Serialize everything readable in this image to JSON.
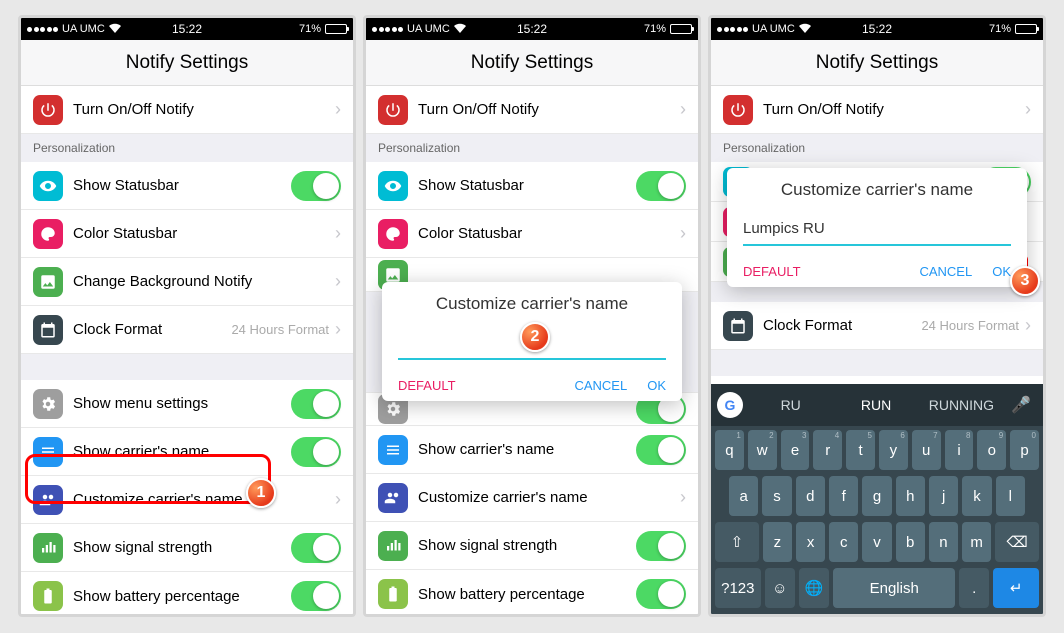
{
  "statusbar": {
    "carrier": "UA UMC",
    "time": "15:22",
    "battery_pct": "71%"
  },
  "title": "Notify Settings",
  "rows": {
    "turn_on_off": "Turn On/Off Notify",
    "personalization": "Personalization",
    "show_statusbar": "Show Statusbar",
    "color_statusbar": "Color Statusbar",
    "change_bg": "Change Background Notify",
    "clock_format": "Clock Format",
    "clock_format_detail": "24 Hours Format",
    "show_menu": "Show menu settings",
    "show_carrier": "Show carrier's name",
    "customize_carrier": "Customize carrier's name",
    "show_signal": "Show signal strength",
    "show_battery": "Show battery percentage"
  },
  "dialog": {
    "title": "Customize carrier's name",
    "empty_value": "",
    "value": "Lumpics RU",
    "default": "DEFAULT",
    "cancel": "CANCEL",
    "ok": "OK"
  },
  "callouts": {
    "n1": "1",
    "n2": "2",
    "n3": "3"
  },
  "keyboard": {
    "suggestions": [
      "RU",
      "RUN",
      "RUNNING"
    ],
    "row1": [
      "q",
      "w",
      "e",
      "r",
      "t",
      "y",
      "u",
      "i",
      "o",
      "p"
    ],
    "row1_sup": [
      "1",
      "2",
      "3",
      "4",
      "5",
      "6",
      "7",
      "8",
      "9",
      "0"
    ],
    "row2": [
      "a",
      "s",
      "d",
      "f",
      "g",
      "h",
      "j",
      "k",
      "l"
    ],
    "row3": [
      "z",
      "x",
      "c",
      "v",
      "b",
      "n",
      "m"
    ],
    "sym": "?123",
    "lang": "English"
  }
}
